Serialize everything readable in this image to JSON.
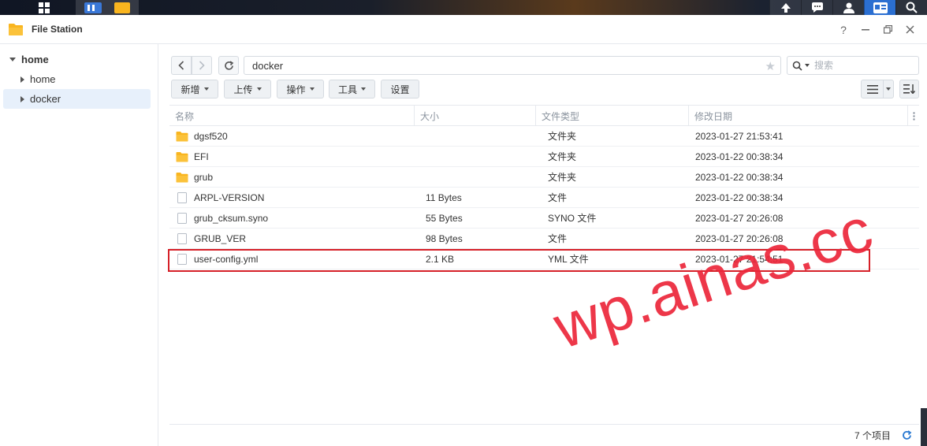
{
  "window": {
    "title": "File Station"
  },
  "sidebar": {
    "root": "home",
    "items": [
      {
        "label": "home",
        "selected": false
      },
      {
        "label": "docker",
        "selected": true
      }
    ]
  },
  "path": {
    "value": "docker"
  },
  "search": {
    "placeholder": "搜索"
  },
  "toolbar": {
    "new_label": "新增",
    "upload_label": "上传",
    "action_label": "操作",
    "tools_label": "工具",
    "settings_label": "设置"
  },
  "table": {
    "columns": [
      "名称",
      "大小",
      "文件类型",
      "修改日期"
    ],
    "rows": [
      {
        "name": "dgsf520",
        "size": "",
        "type": "文件夹",
        "modified": "2023-01-27 21:53:41",
        "icon": "folder-icon"
      },
      {
        "name": "EFI",
        "size": "",
        "type": "文件夹",
        "modified": "2023-01-22 00:38:34",
        "icon": "folder-icon"
      },
      {
        "name": "grub",
        "size": "",
        "type": "文件夹",
        "modified": "2023-01-22 00:38:34",
        "icon": "folder-icon"
      },
      {
        "name": "ARPL-VERSION",
        "size": "11 Bytes",
        "type": "文件",
        "modified": "2023-01-22 00:38:34",
        "icon": "file-icon"
      },
      {
        "name": "grub_cksum.syno",
        "size": "55 Bytes",
        "type": "SYNO 文件",
        "modified": "2023-01-27 20:26:08",
        "icon": "file-icon"
      },
      {
        "name": "GRUB_VER",
        "size": "98 Bytes",
        "type": "文件",
        "modified": "2023-01-27 20:26:08",
        "icon": "file-icon"
      },
      {
        "name": "user-config.yml",
        "size": "2.1 KB",
        "type": "YML 文件",
        "modified": "2023-01-27 21:54:51",
        "icon": "file-icon"
      }
    ]
  },
  "status": {
    "item_count": "7 个项目"
  },
  "watermark": {
    "text": "wp.ainas.cc"
  },
  "colors": {
    "highlight": "#d62028",
    "folder": "#f9b51f",
    "watermark": "#eb263a",
    "selected_bg": "#e7f0fb"
  }
}
